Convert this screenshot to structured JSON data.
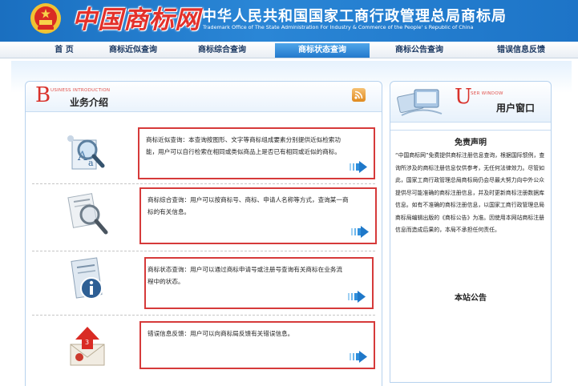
{
  "header": {
    "logo_text": "中国商标网",
    "agency_title": "中华人民共和国国家工商行政管理总局商标局",
    "agency_subtitle": "Trademark Office of The State Administration For Industry & Commerce of the People' s Republic of China"
  },
  "nav": {
    "items": [
      {
        "label": "首  页",
        "active": false
      },
      {
        "label": "商标近似查询",
        "active": false
      },
      {
        "label": "商标综合查询",
        "active": false
      },
      {
        "label": "商标状态查询",
        "active": true
      },
      {
        "label": "商标公告查询",
        "active": false
      },
      {
        "label": "错误信息反馈",
        "active": false
      }
    ]
  },
  "main_panel": {
    "letter": "B",
    "english": "USINESS INTRODUCTION",
    "title": "业务介绍",
    "services": [
      {
        "text": "商标近似查询：本查询按图形、文字等商标组成要素分别提供近似检索功能，用户可以自行检索在相同或类似商品上是否已有相同或近似的商标。",
        "icon": "magnifier-aa-icon"
      },
      {
        "text": "商标综合查询：用户可以按商标号、商标、申请人名称等方式，查询某一商标的有关信息。",
        "icon": "magnifier-document-icon"
      },
      {
        "text": "商标状态查询：用户可以通过商标申请号或注册号查询有关商标在业务流程中的状态。",
        "icon": "info-document-icon"
      },
      {
        "text": "错误信息反馈：用户可以向商标局反馈有关错误信息。",
        "icon": "feedback-envelope-icon"
      }
    ]
  },
  "user_panel": {
    "letter": "U",
    "english": "SER WINDOW",
    "title": "用户窗口",
    "disclaimer_title": "免责声明",
    "disclaimer_body": "“中国商标网”免费提供商标注册信息查询，根据国际惯例，查询所涉及的商标注册信息仅供参考，无任何法律效力。尽管如此，国家工商行政管理总局商标局仍会尽最大努力向中外公众提供尽可能准确的商标注册信息，并及时更新商标注册数据库信息。如有不准确的商标注册信息，以国家工商行政管理总局商标局编辑出版的《商标公告》为准。因使用本网站商标注册信息而造成后果的，本局不承担任何责任。",
    "announce_title": "本站公告"
  },
  "colors": {
    "header_blue": "#2a86d6",
    "accent_red": "#d63a3a",
    "nav_active": "#2379cc"
  }
}
